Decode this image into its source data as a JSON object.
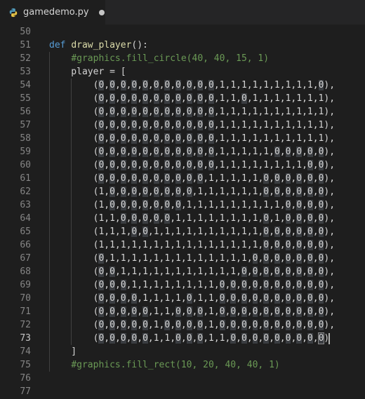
{
  "tab": {
    "title": "gamedemo.py",
    "icon": "python-icon",
    "modified": true
  },
  "editor": {
    "active_line": 73,
    "lines": [
      {
        "n": "50",
        "text": ""
      },
      {
        "n": "51",
        "text": "def draw_player():"
      },
      {
        "n": "52",
        "text": "    #graphics.fill_circle(40, 40, 15, 1)"
      },
      {
        "n": "53",
        "text": "    player = ["
      },
      {
        "n": "54",
        "text": "        (0,0,0,0,0,0,0,0,0,0,0,1,1,1,1,1,1,1,1,1,0),"
      },
      {
        "n": "55",
        "text": "        (0,0,0,0,0,0,0,0,0,0,0,1,1,0,1,1,1,1,1,1,1),"
      },
      {
        "n": "56",
        "text": "        (0,0,0,0,0,0,0,0,0,0,0,1,1,1,1,1,1,1,1,1,1),"
      },
      {
        "n": "57",
        "text": "        (0,0,0,0,0,0,0,0,0,0,0,1,1,1,1,1,1,1,1,1,1),"
      },
      {
        "n": "58",
        "text": "        (0,0,0,0,0,0,0,0,0,0,0,1,1,1,1,1,1,1,1,1,1),"
      },
      {
        "n": "59",
        "text": "        (0,0,0,0,0,0,0,0,0,0,0,1,1,1,1,1,0,0,0,0,0),"
      },
      {
        "n": "60",
        "text": "        (0,0,0,0,0,0,0,0,0,0,0,1,1,1,1,1,1,1,1,0,0),"
      },
      {
        "n": "61",
        "text": "        (0,0,0,0,0,0,0,0,0,0,1,1,1,1,1,0,0,0,0,0,0),"
      },
      {
        "n": "62",
        "text": "        (1,0,0,0,0,0,0,0,0,1,1,1,1,1,1,0,0,0,0,0,0),"
      },
      {
        "n": "63",
        "text": "        (1,0,0,0,0,0,0,0,1,1,1,1,1,1,1,1,1,0,0,0,0),"
      },
      {
        "n": "64",
        "text": "        (1,1,0,0,0,0,0,1,1,1,1,1,1,1,1,0,1,0,0,0,0),"
      },
      {
        "n": "65",
        "text": "        (1,1,1,0,0,1,1,1,1,1,1,1,1,1,1,0,0,0,0,0,0),"
      },
      {
        "n": "66",
        "text": "        (1,1,1,1,1,1,1,1,1,1,1,1,1,1,1,0,0,0,0,0,0),"
      },
      {
        "n": "67",
        "text": "        (0,1,1,1,1,1,1,1,1,1,1,1,1,1,0,0,0,0,0,0,0),"
      },
      {
        "n": "68",
        "text": "        (0,0,1,1,1,1,1,1,1,1,1,1,1,0,0,0,0,0,0,0,0),"
      },
      {
        "n": "69",
        "text": "        (0,0,0,1,1,1,1,1,1,1,1,0,0,0,0,0,0,0,0,0,0),"
      },
      {
        "n": "70",
        "text": "        (0,0,0,0,1,1,1,1,0,1,1,0,0,0,0,0,0,0,0,0,0),"
      },
      {
        "n": "71",
        "text": "        (0,0,0,0,0,1,1,0,0,0,1,0,0,0,0,0,0,0,0,0,0),"
      },
      {
        "n": "72",
        "text": "        (0,0,0,0,0,1,0,0,0,0,1,0,0,0,0,0,0,0,0,0,0),"
      },
      {
        "n": "73",
        "text": "        (0,0,0,0,0,1,1,0,0,0,1,1,0,0,0,0,0,0,0,0,0)"
      },
      {
        "n": "74",
        "text": "    ]"
      },
      {
        "n": "75",
        "text": "    #graphics.fill_rect(10, 20, 40, 40, 1)"
      },
      {
        "n": "76",
        "text": ""
      },
      {
        "n": "77",
        "text": ""
      }
    ]
  }
}
